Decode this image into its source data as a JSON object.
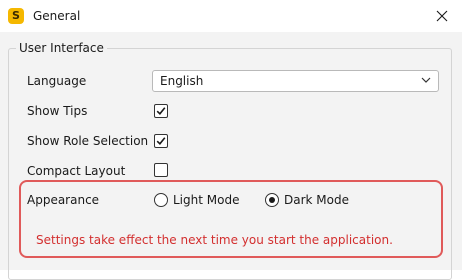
{
  "window": {
    "title": "General",
    "icon_letter": "S",
    "icon_color": "#f5b800"
  },
  "group": {
    "title": "User Interface"
  },
  "language": {
    "label": "Language",
    "value": "English"
  },
  "settings": {
    "show_tips": {
      "label": "Show Tips",
      "checked": true
    },
    "show_role_selection": {
      "label": "Show Role Selection",
      "checked": true
    },
    "compact_layout": {
      "label": "Compact Layout",
      "checked": false
    }
  },
  "appearance": {
    "label": "Appearance",
    "options": [
      {
        "label": "Light Mode",
        "selected": false
      },
      {
        "label": "Dark Mode",
        "selected": true
      }
    ]
  },
  "note": {
    "text": "Settings take effect the next time you start the application.",
    "color": "#d32f2f"
  },
  "highlight_color": "#e05a5a"
}
